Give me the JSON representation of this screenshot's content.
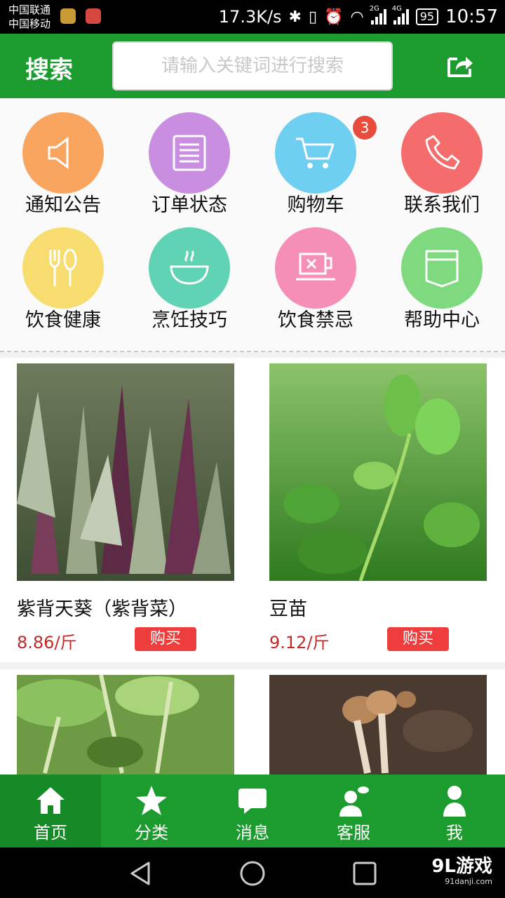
{
  "status_bar": {
    "carrier1": "中国联通",
    "carrier2": "中国移动",
    "speed": "17.3K/s",
    "net1": "2G",
    "net2": "4G",
    "battery": "95",
    "time": "10:57"
  },
  "header": {
    "title": "搜索",
    "search_placeholder": "请输入关键词进行搜索",
    "share_icon": "share-icon"
  },
  "menu": {
    "items": [
      {
        "label": "通知公告",
        "icon": "speaker-icon",
        "color": "#f9a45f"
      },
      {
        "label": "订单状态",
        "icon": "list-icon",
        "color": "#c98ee0"
      },
      {
        "label": "购物车",
        "icon": "cart-icon",
        "color": "#6fcff0",
        "badge": "3"
      },
      {
        "label": "联系我们",
        "icon": "phone-icon",
        "color": "#f56c6c"
      },
      {
        "label": "饮食健康",
        "icon": "fork-spoon-icon",
        "color": "#f7dc6f"
      },
      {
        "label": "烹饪技巧",
        "icon": "bowl-icon",
        "color": "#5fd3b4"
      },
      {
        "label": "饮食禁忌",
        "icon": "forbidden-cup-icon",
        "color": "#f58fb8"
      },
      {
        "label": "帮助中心",
        "icon": "pocket-icon",
        "color": "#7fd97f"
      }
    ]
  },
  "products": [
    {
      "name": "紫背天葵（紫背菜）",
      "price": "8.86/斤",
      "buy": "购买"
    },
    {
      "name": "豆苗",
      "price": "9.12/斤",
      "buy": "购买"
    },
    {
      "name": "",
      "price": "",
      "buy": ""
    },
    {
      "name": "",
      "price": "",
      "buy": ""
    }
  ],
  "tabs": [
    {
      "label": "首页",
      "icon": "home-icon"
    },
    {
      "label": "分类",
      "icon": "star-icon"
    },
    {
      "label": "消息",
      "icon": "message-icon"
    },
    {
      "label": "客服",
      "icon": "customer-service-icon"
    },
    {
      "label": "我",
      "icon": "person-icon"
    }
  ],
  "watermark": {
    "brand": "9L游戏",
    "site": "91danji.com"
  },
  "colors": {
    "primary": "#1c9b2f",
    "price": "#c62828",
    "buy_button": "#ee3d3d"
  }
}
